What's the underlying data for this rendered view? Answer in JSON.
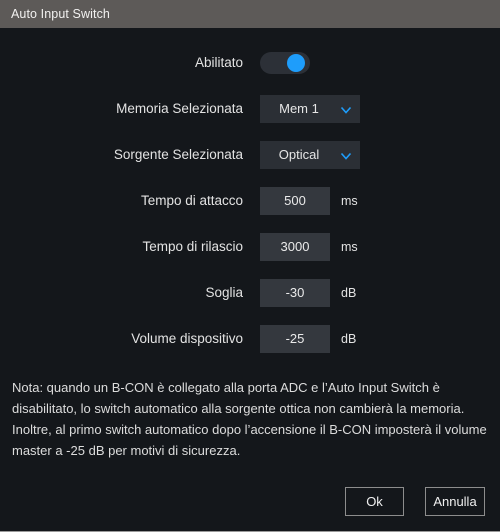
{
  "window": {
    "title": "Auto Input Switch",
    "background_color": "#14171b",
    "titlebar_color": "#5d5a58",
    "accent_color": "#1e9dfb"
  },
  "form": {
    "rows": [
      {
        "label": "Abilitato",
        "type": "toggle",
        "value": "on",
        "unit": ""
      },
      {
        "label": "Memoria Selezionata",
        "type": "dropdown",
        "value": "Mem 1",
        "unit": ""
      },
      {
        "label": "Sorgente Selezionata",
        "type": "dropdown",
        "value": "Optical",
        "unit": ""
      },
      {
        "label": "Tempo di attacco",
        "type": "textbox",
        "value": "500",
        "unit": "ms"
      },
      {
        "label": "Tempo di rilascio",
        "type": "textbox",
        "value": "3000",
        "unit": "ms"
      },
      {
        "label": "Soglia",
        "type": "textbox",
        "value": "-30",
        "unit": "dB"
      },
      {
        "label": "Volume dispositivo",
        "type": "textbox",
        "value": "-25",
        "unit": "dB"
      }
    ]
  },
  "note": {
    "text": "Nota: quando un B-CON è collegato alla porta ADC e l’Auto Input Switch è disabilitato, lo switch automatico alla sorgente ottica non cambierà la memoria. Inoltre, al primo switch automatico dopo l’accensione il B-CON imposterà il volume master a -25 dB per motivi di sicurezza."
  },
  "footer": {
    "ok_label": "Ok",
    "cancel_label": "Annulla"
  },
  "icons": {
    "chevron_down": "chevron-down-icon"
  }
}
